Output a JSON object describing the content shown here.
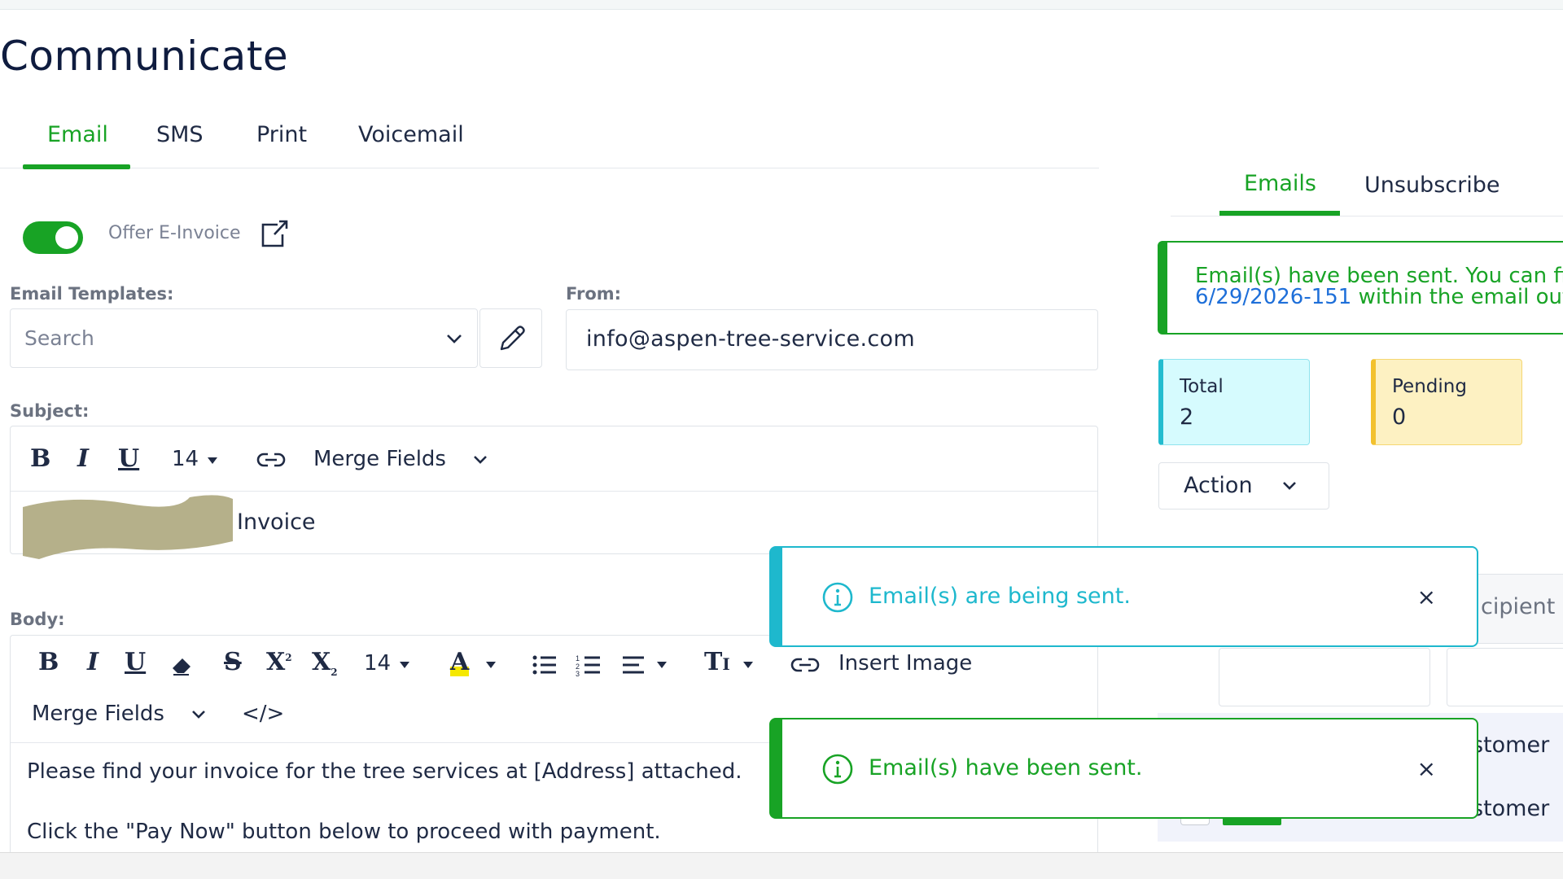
{
  "page": {
    "title": "Communicate"
  },
  "tabs": [
    "Email",
    "SMS",
    "Print",
    "Voicemail"
  ],
  "options": {
    "offer_einvoice_label": "Offer E-Invoice",
    "offer_einvoice_enabled": true
  },
  "templates": {
    "label": "Email Templates:",
    "placeholder": "Search"
  },
  "from": {
    "label": "From:",
    "value": "info@aspen-tree-service.com"
  },
  "subject": {
    "label": "Subject:",
    "font_size": "14",
    "merge_fields_label": "Merge Fields",
    "visible_text": "Invoice"
  },
  "body": {
    "label": "Body:",
    "font_size": "14",
    "insert_image_label": "Insert Image",
    "merge_fields_label": "Merge Fields",
    "code_label": "</>",
    "lines": [
      "Please find your invoice for the tree services at [Address] attached.",
      "Click the \"Pay Now\" button below to proceed with payment."
    ]
  },
  "right_panel": {
    "tabs": [
      "Emails",
      "Unsubscribe"
    ],
    "banner": {
      "line1": "Email(s) have been sent. You can fil",
      "line2_link": "6/29/2026-151",
      "line2_rest": " within the email out"
    },
    "stats": {
      "total_label": "Total",
      "total_value": "2",
      "pending_label": "Pending",
      "pending_value": "0"
    },
    "action_label": "Action",
    "filter_partial": "cipient ..",
    "rows_partial": [
      "stomer",
      "stomer"
    ]
  },
  "toasts": [
    {
      "type": "info",
      "message": "Email(s) are being sent.",
      "close": "×"
    },
    {
      "type": "success",
      "message": "Email(s) have been sent.",
      "close": "×"
    }
  ],
  "colors": {
    "accent_green": "#18a325",
    "info_teal": "#1eb8cd",
    "link_blue": "#1e6fd9",
    "title_navy": "#0f1c3f",
    "total_bg": "#d6fbfe",
    "pending_bg": "#fdf1c2"
  }
}
